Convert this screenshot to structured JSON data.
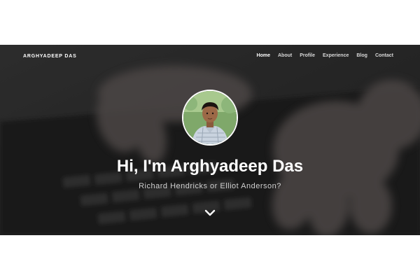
{
  "brand": "ARGHYADEEP DAS",
  "nav": {
    "items": [
      {
        "label": "Home",
        "active": true
      },
      {
        "label": "About",
        "active": false
      },
      {
        "label": "Profile",
        "active": false
      },
      {
        "label": "Experience",
        "active": false
      },
      {
        "label": "Blog",
        "active": false
      },
      {
        "label": "Contact",
        "active": false
      }
    ]
  },
  "hero": {
    "title": "Hi, I'm Arghyadeep Das",
    "subtitle": "Richard Hendricks or Elliot Anderson?",
    "scroll_icon": "chevron-down-icon",
    "background": "blurred-keyboard-hands-photo"
  },
  "colors": {
    "overlay": "#2b2b2b",
    "text_primary": "#ffffff",
    "text_secondary": "#d0d0d0"
  }
}
